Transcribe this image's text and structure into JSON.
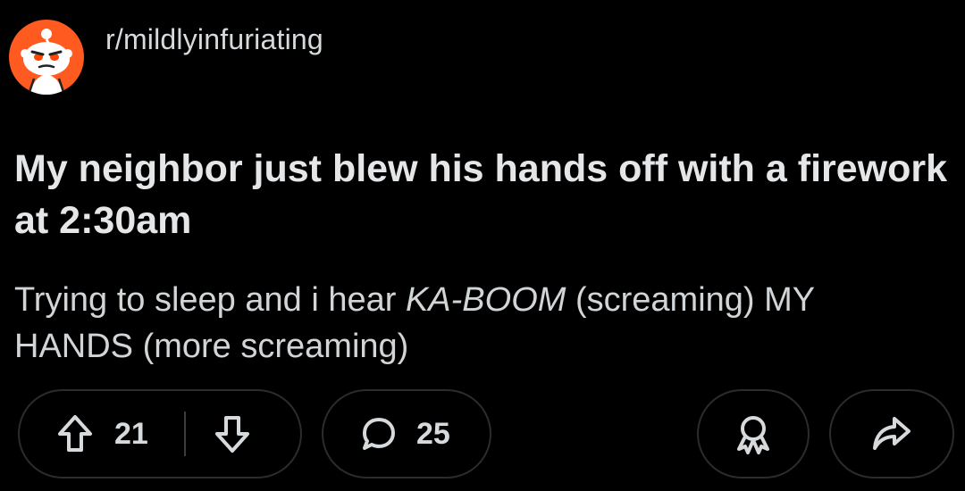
{
  "post": {
    "subreddit": "r/mildlyinfuriating",
    "title": "My neighbor just blew his hands off with a firework at 2:30am",
    "body": {
      "part1": "Trying to sleep and i hear ",
      "emphasis": "KA-BOOM",
      "part2": "  (screaming) MY",
      "line2": "HANDS (more screaming)"
    }
  },
  "actions": {
    "upvote_icon": "upvote-arrow-icon",
    "score": "21",
    "downvote_icon": "downvote-arrow-icon",
    "comment_icon": "comment-bubble-icon",
    "comments": "25",
    "award_icon": "award-icon",
    "share_icon": "share-arrow-icon"
  },
  "colors": {
    "background": "#000000",
    "text": "#d7dadc",
    "avatar_bg": "#ff5a1f",
    "pill_border": "#2a2c2e"
  }
}
